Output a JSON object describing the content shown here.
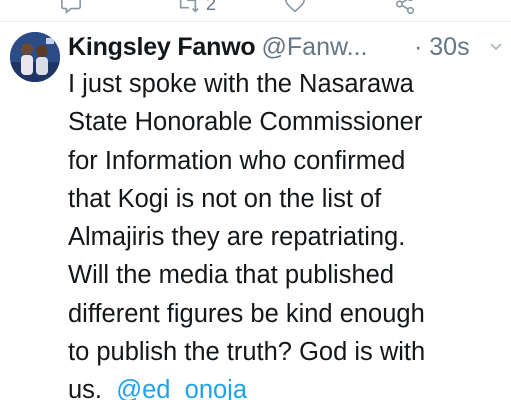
{
  "previous_tweet": {
    "retweet_count": "2"
  },
  "tweet": {
    "display_name": "Kingsley Fanwo",
    "handle": "@Fanw...",
    "timestamp": "· 30s",
    "body_lines": [
      "I just spoke with the Nasarawa",
      "State Honorable Commissioner",
      "for Information who confirmed",
      "that Kogi is not on the list of",
      "Almajiris they are repatriating.",
      "Will the media that published",
      "different figures be kind enough",
      "to publish the truth? God is with",
      "us."
    ],
    "mention": "@ed_onoja"
  },
  "colors": {
    "link": "#1da1f2",
    "secondary_text": "#657786",
    "icon": "#8899a6"
  }
}
